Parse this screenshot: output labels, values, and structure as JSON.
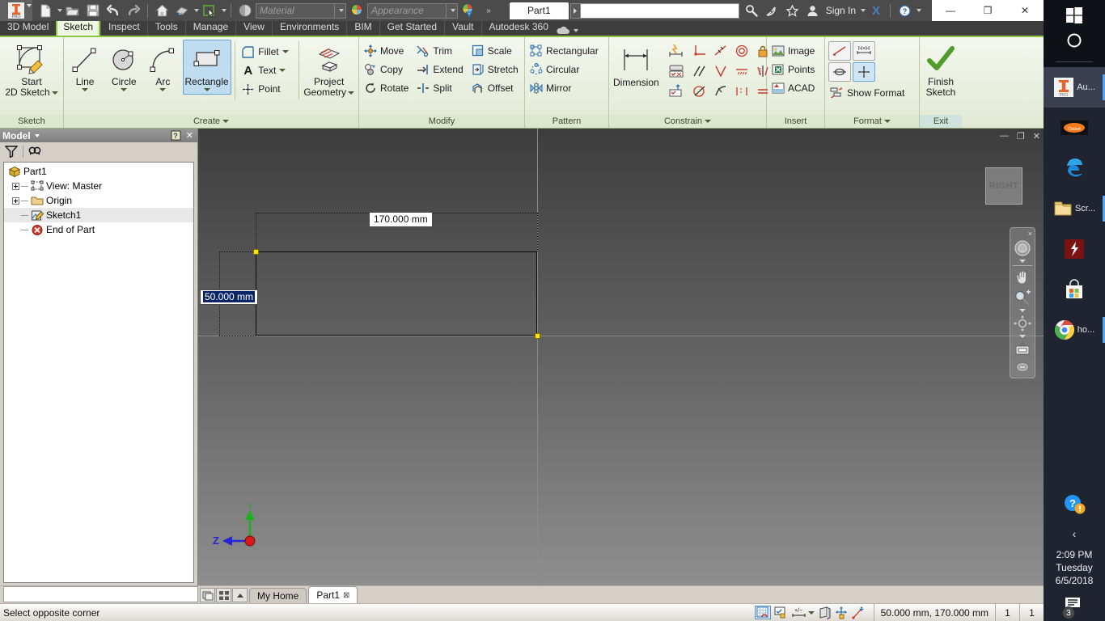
{
  "app": {
    "document_title": "Part1",
    "product": "Autodesk Inventor Professional"
  },
  "quick_access": {
    "items": [
      {
        "name": "new",
        "label": "New"
      },
      {
        "name": "open",
        "label": "Open"
      },
      {
        "name": "save",
        "label": "Save"
      },
      {
        "name": "undo",
        "label": "Undo"
      },
      {
        "name": "redo",
        "label": "Redo"
      },
      {
        "name": "home",
        "label": "Home"
      },
      {
        "name": "return",
        "label": "Return"
      },
      {
        "name": "select",
        "label": "Select"
      },
      {
        "name": "appearance-sphere",
        "label": "Appearance"
      }
    ],
    "material_placeholder": "Material",
    "appearance_placeholder": "Appearance",
    "overflow_label": "»"
  },
  "titlebar": {
    "search_value": "",
    "sign_in_label": "Sign In",
    "help_label": "?",
    "exchange_label": "X",
    "minimize_label": "—",
    "restore_label": "❐",
    "close_label": "✕"
  },
  "ribbon": {
    "tabs": [
      {
        "label": "3D Model",
        "active": false
      },
      {
        "label": "Sketch",
        "active": true
      },
      {
        "label": "Inspect",
        "active": false
      },
      {
        "label": "Tools",
        "active": false
      },
      {
        "label": "Manage",
        "active": false
      },
      {
        "label": "View",
        "active": false
      },
      {
        "label": "Environments",
        "active": false
      },
      {
        "label": "BIM",
        "active": false
      },
      {
        "label": "Get Started",
        "active": false
      },
      {
        "label": "Vault",
        "active": false
      },
      {
        "label": "Autodesk 360",
        "active": false
      }
    ],
    "panels": {
      "sketch": {
        "title": "Sketch",
        "start_2d_sketch": "Start\n2D Sketch",
        "start_2d_sketch_line1": "Start",
        "start_2d_sketch_line2": "2D Sketch"
      },
      "create": {
        "title": "Create",
        "line": "Line",
        "circle": "Circle",
        "arc": "Arc",
        "rectangle": "Rectangle",
        "fillet": "Fillet",
        "text": "Text",
        "point": "Point",
        "project_geometry_line1": "Project",
        "project_geometry_line2": "Geometry"
      },
      "modify": {
        "title": "Modify",
        "move": "Move",
        "copy": "Copy",
        "rotate": "Rotate",
        "trim": "Trim",
        "extend": "Extend",
        "split": "Split",
        "scale": "Scale",
        "stretch": "Stretch",
        "offset": "Offset"
      },
      "pattern": {
        "title": "Pattern",
        "rectangular": "Rectangular",
        "circular": "Circular",
        "mirror": "Mirror"
      },
      "constrain": {
        "title": "Constrain",
        "dimension": "Dimension",
        "tools": [
          "auto-dimension-icon",
          "perpendicular-icon",
          "tangent-icon",
          "concentric-icon",
          "fix-icon",
          "constraint-settings-icon",
          "parallel-icon",
          "coincident-icon",
          "collinear-icon",
          "symmetric-icon",
          "show-constraints-icon",
          "smooth-icon",
          "horizontal-icon",
          "vertical-icon",
          "equal-icon"
        ]
      },
      "insert": {
        "title": "Insert",
        "image": "Image",
        "points": "Points",
        "acad": "ACAD"
      },
      "format": {
        "title": "Format",
        "show_format": "Show Format",
        "tools": [
          "construction-line-icon",
          "driven-dimension-icon",
          "centerline-icon",
          "center-point-icon"
        ]
      },
      "exit": {
        "title": "Exit",
        "finish_sketch_line1": "Finish",
        "finish_sketch_line2": "Sketch"
      }
    }
  },
  "browser": {
    "title": "Model",
    "help_icon": "help-icon",
    "filter_icon": "filter-icon",
    "find_icon": "find-icon",
    "tree": [
      {
        "label": "Part1",
        "icon": "part-icon",
        "expander": "none",
        "depth": 0,
        "selected": false
      },
      {
        "label": "View: Master",
        "icon": "view-icon",
        "expander": "plus",
        "depth": 1,
        "selected": false
      },
      {
        "label": "Origin",
        "icon": "folder-icon",
        "expander": "plus",
        "depth": 1,
        "selected": false
      },
      {
        "label": "Sketch1",
        "icon": "sketch-icon",
        "expander": "line",
        "depth": 1,
        "selected": true
      },
      {
        "label": "End of Part",
        "icon": "end-of-part-icon",
        "expander": "line",
        "depth": 1,
        "selected": false
      }
    ]
  },
  "canvas": {
    "view_cube_label": "RIGHT",
    "dimension_width": "170.000 mm",
    "dimension_height": "50.000 mm",
    "axis_labels": {
      "vertical": "Y",
      "horizontal": "Z"
    },
    "graphics_window_controls": {
      "minimize": "—",
      "restore": "❐",
      "close": "✕"
    },
    "nav_bar": {
      "close": "×",
      "items": [
        "steering-wheel-icon",
        "pan-icon",
        "zoom-icon",
        "orbit-icon",
        "look-at-icon",
        "nav-settings-icon"
      ]
    }
  },
  "doc_tabs": {
    "view_icons": [
      "tile-windows-icon",
      "thumbnail-view-icon",
      "scroll-up-icon"
    ],
    "tabs": [
      {
        "label": "My Home",
        "active": false,
        "closable": false
      },
      {
        "label": "Part1",
        "active": true,
        "closable": true
      }
    ]
  },
  "status_bar": {
    "message": "Select opposite corner",
    "tools": [
      "snap-to-grid-icon",
      "dimension-display-icon",
      "plus-minus-icon",
      "slice-graphics-icon",
      "construction-icon",
      "point-icon"
    ],
    "coordinates": "50.000 mm, 170.000 mm",
    "count_1": "1",
    "count_2": "1"
  },
  "taskbar": {
    "start_label": "start-icon",
    "cortana_label": "cortana-icon",
    "items": [
      {
        "name": "inventor",
        "label": "Au...",
        "active": true,
        "running": true
      },
      {
        "name": "cricket",
        "label": "",
        "active": false,
        "running": false
      },
      {
        "name": "edge",
        "label": "",
        "active": false,
        "running": false
      },
      {
        "name": "file-explorer",
        "label": "Scr...",
        "active": false,
        "running": true
      },
      {
        "name": "flash",
        "label": "",
        "active": false,
        "running": false
      },
      {
        "name": "microsoft-store",
        "label": "",
        "active": false,
        "running": false
      },
      {
        "name": "chrome",
        "label": "ho...",
        "active": false,
        "running": true
      }
    ],
    "help_icon": "help-notification-icon",
    "chevron": "‹",
    "time": "2:09 PM",
    "day": "Tuesday",
    "date": "6/5/2018",
    "notification_count": "3"
  },
  "colors": {
    "accent_green": "#8dc63f",
    "selected_blue": "#bfdcf0",
    "ribbon_bg": "#e6edda",
    "titlebar": "#4b4b4b",
    "vertex_yellow": "#ffe500",
    "taskbar": "#1f2430"
  }
}
